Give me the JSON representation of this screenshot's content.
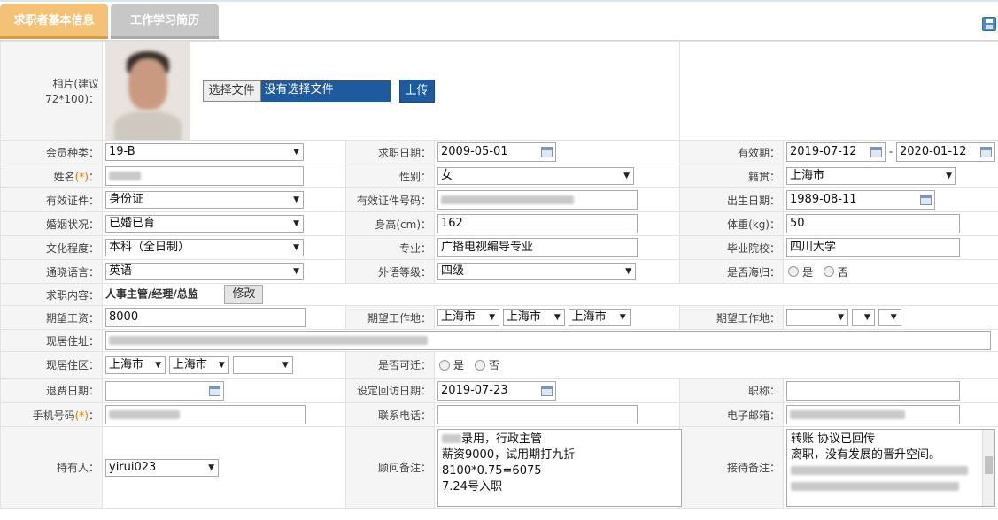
{
  "tabs": [
    {
      "label": "求职者基本信息",
      "active": true
    },
    {
      "label": "工作学习简历",
      "active": false
    }
  ],
  "photo": {
    "label": "相片(建议72*100)：",
    "file_button": "选择文件",
    "file_status": "没有选择文件",
    "upload_button": "上传"
  },
  "row1": {
    "member_type": {
      "label": "会员种类：",
      "value": "19-B"
    },
    "apply_date": {
      "label": "求职日期：",
      "value": "2009-05-01"
    },
    "validity": {
      "label": "有效期：",
      "from": "2019-07-12",
      "sep": "-",
      "to": "2020-01-12"
    }
  },
  "row2": {
    "name": {
      "label": "姓名",
      "req": "(*)",
      "colon": "："
    },
    "gender": {
      "label": "性别：",
      "value": "女"
    },
    "native": {
      "label": "籍贯：",
      "value": "上海市"
    }
  },
  "row3": {
    "id_type": {
      "label": "有效证件：",
      "value": "身份证"
    },
    "id_no": {
      "label": "有效证件号码："
    },
    "birth": {
      "label": "出生日期：",
      "value": "1989-08-11"
    }
  },
  "row4": {
    "marital": {
      "label": "婚姻状况：",
      "value": "已婚已育"
    },
    "height": {
      "label": "身高(cm)：",
      "value": "162"
    },
    "weight": {
      "label": "体重(kg)：",
      "value": "50"
    }
  },
  "row5": {
    "education": {
      "label": "文化程度：",
      "value": "本科（全日制）"
    },
    "major": {
      "label": "专业：",
      "value": "广播电视编导专业"
    },
    "school": {
      "label": "毕业院校：",
      "value": "四川大学"
    }
  },
  "row6": {
    "language": {
      "label": "通晓语言：",
      "value": "英语"
    },
    "lang_level": {
      "label": "外语等级：",
      "value": "四级"
    },
    "overseas": {
      "label": "是否海归：",
      "yes": "是",
      "no": "否"
    }
  },
  "row7": {
    "job_content": {
      "label": "求职内容：",
      "value": "人事主管/经理/总监",
      "edit": "修改"
    }
  },
  "row8": {
    "salary": {
      "label": "期望工资：",
      "value": "8000"
    },
    "work_place1": {
      "label": "期望工作地：",
      "v1": "上海市",
      "v2": "上海市",
      "v3": "上海市"
    },
    "work_place2": {
      "label": "期望工作地："
    }
  },
  "row9": {
    "address": {
      "label": "现居住址："
    }
  },
  "row10": {
    "district": {
      "label": "现居住区：",
      "v1": "上海市",
      "v2": "上海市"
    },
    "relocate": {
      "label": "是否可迁：",
      "yes": "是",
      "no": "否"
    }
  },
  "row11": {
    "refund_date": {
      "label": "退费日期："
    },
    "revisit_date": {
      "label": "设定回访日期：",
      "value": "2019-07-23"
    },
    "title": {
      "label": "职称："
    }
  },
  "row12": {
    "mobile": {
      "label": "手机号码",
      "req": "(*)",
      "colon": "："
    },
    "phone": {
      "label": "联系电话："
    },
    "email": {
      "label": "电子邮箱："
    }
  },
  "row13": {
    "holder": {
      "label": "持有人：",
      "value": "yirui023"
    },
    "advisor_note": {
      "label": "顾问备注：",
      "lines": [
        "录用，行政主管",
        "薪资9000，试用期打九折",
        "8100*0.75=6075",
        "7.24号入职"
      ]
    },
    "reception_note": {
      "label": "接待备注：",
      "lines": [
        "转账 协议已回传",
        "离职，没有发展的晋升空间。"
      ]
    }
  },
  "icons": {
    "save": "save-icon",
    "calendar": "calendar-icon",
    "dropdown": "chevron-down-icon"
  }
}
